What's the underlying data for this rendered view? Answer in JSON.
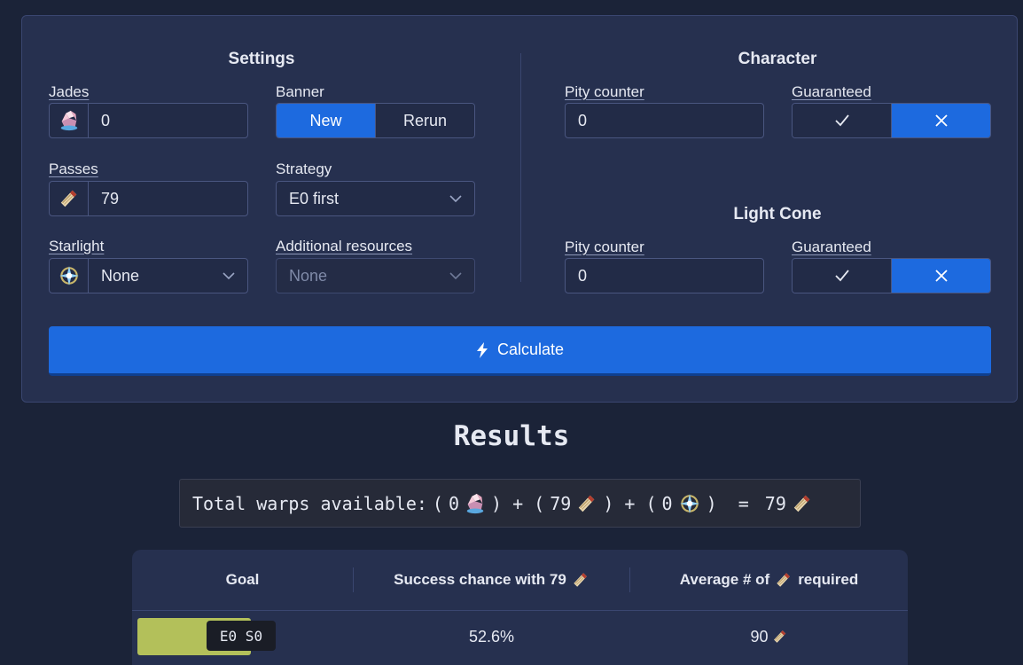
{
  "settings": {
    "title": "Settings",
    "jades": {
      "label": "Jades",
      "value": "0"
    },
    "banner": {
      "label": "Banner",
      "options": [
        "New",
        "Rerun"
      ],
      "selected": "New"
    },
    "passes": {
      "label": "Passes",
      "value": "79"
    },
    "strategy": {
      "label": "Strategy",
      "value": "E0 first"
    },
    "starlight": {
      "label": "Starlight",
      "value": "None"
    },
    "additional": {
      "label": "Additional resources",
      "value": "None"
    }
  },
  "character": {
    "title": "Character",
    "pity_label": "Pity counter",
    "pity_value": "0",
    "guaranteed_label": "Guaranteed",
    "guaranteed_selected": "no"
  },
  "light_cone": {
    "title": "Light Cone",
    "pity_label": "Pity counter",
    "pity_value": "0",
    "guaranteed_label": "Guaranteed",
    "guaranteed_selected": "no"
  },
  "calculate": {
    "label": "Calculate"
  },
  "results": {
    "title": "Results",
    "total": {
      "prefix": "Total warps available:",
      "jades": "0",
      "passes": "79",
      "starlight": "0",
      "result": "79"
    },
    "table": {
      "headers": {
        "goal": "Goal",
        "success": "Success chance with 79",
        "average_prefix": "Average # of",
        "average_suffix": "required"
      },
      "rows": [
        {
          "goal": "E0 S0",
          "success": "52.6%",
          "average": "90"
        }
      ]
    }
  },
  "colors": {
    "accent": "#1d6adf",
    "panel": "#26304f",
    "background": "#1b2338",
    "progress": "#b3c05a"
  }
}
